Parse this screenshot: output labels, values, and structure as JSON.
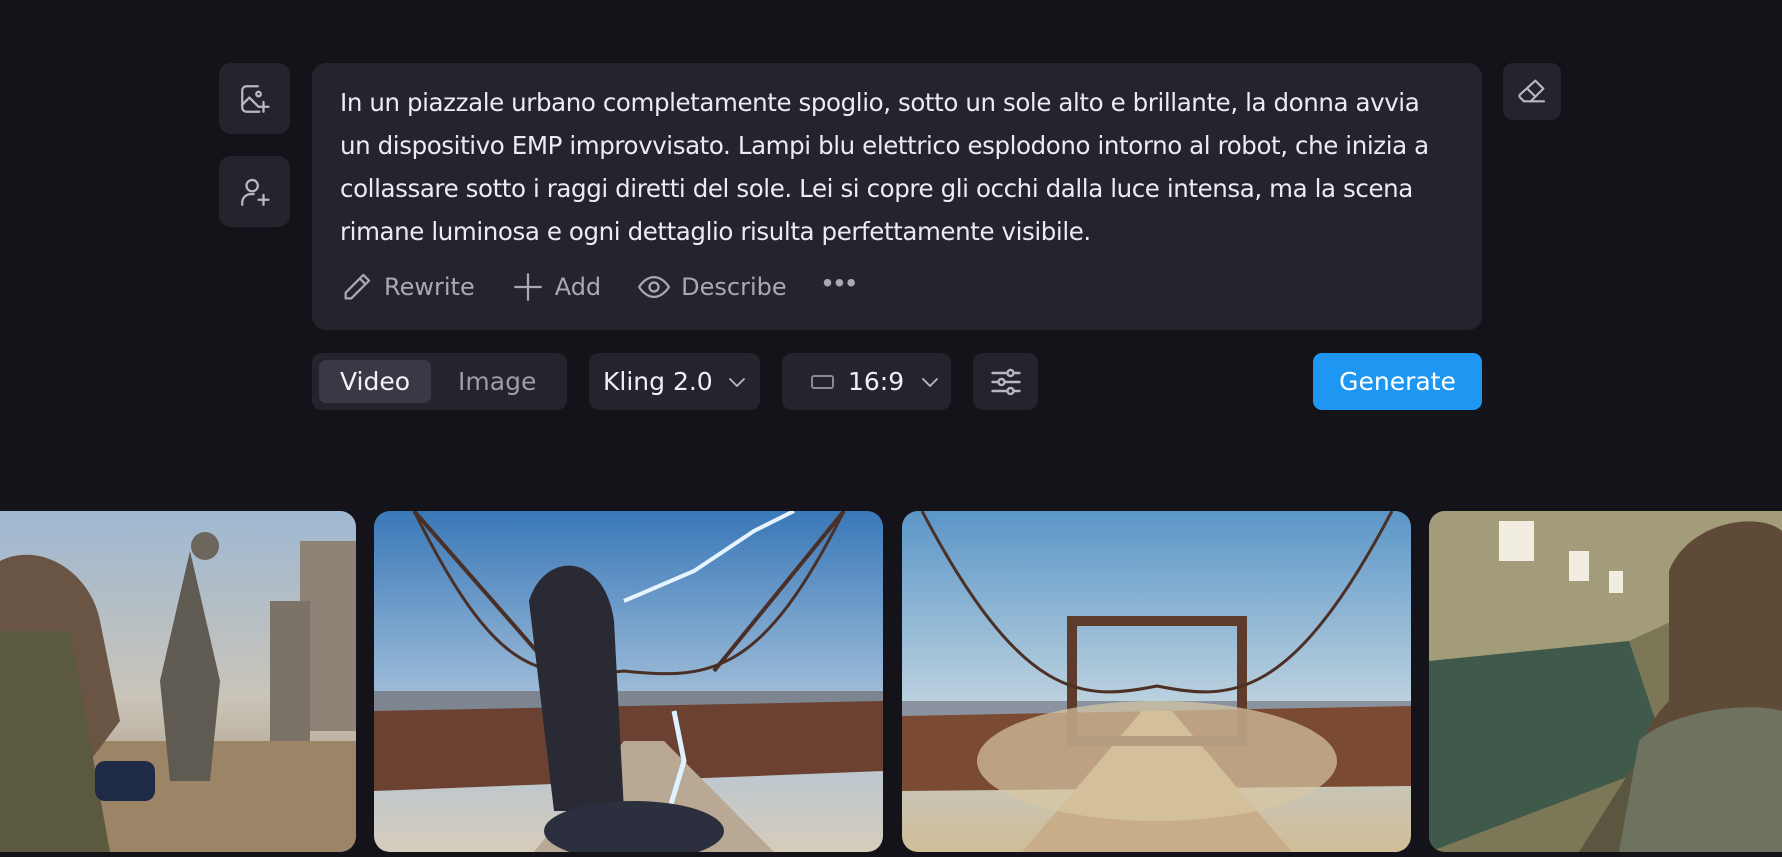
{
  "sidebar": {
    "add_image_icon": "image-plus-icon",
    "add_character_icon": "user-plus-icon"
  },
  "prompt": {
    "text": "In un piazzale urbano completamente spoglio, sotto un sole alto e brillante, la donna avvia un dispositivo EMP improvvisato. Lampi blu elettrico esplodono intorno al robot, che inizia a collassare sotto i raggi diretti del sole. Lei si copre gli occhi dalla luce intensa, ma la scena rimane luminosa e ogni dettaglio risulta perfettamente visibile."
  },
  "actions": {
    "rewrite": "Rewrite",
    "add": "Add",
    "describe": "Describe",
    "more": "•••"
  },
  "toolbar": {
    "modes": [
      "Video",
      "Image"
    ],
    "active_mode": "Video",
    "model": "Kling 2.0",
    "aspect_ratio": "16:9",
    "generate": "Generate"
  },
  "colors": {
    "background": "#14131a",
    "panel": "#25242d",
    "accent": "#1e97f3"
  },
  "gallery": {
    "thumbnails": [
      "woman-shielding-eyes-robot-ruins",
      "woman-lightning-bridge",
      "empty-bridge-dust",
      "woman-corridor"
    ]
  }
}
